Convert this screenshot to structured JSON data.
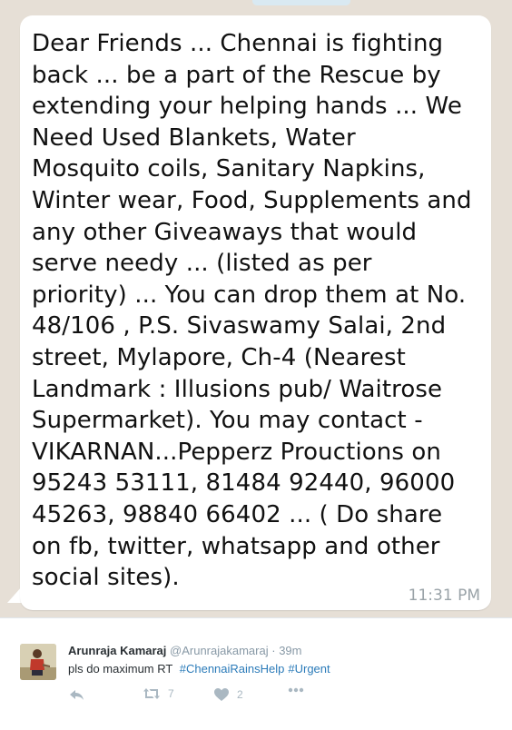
{
  "message": {
    "lines": [
      "Dear Friends ... Chennai is fighting",
      "back ...  be a part of the Rescue  by",
      "extending your helping hands ... We",
      "Need Used Blankets, Water",
      "Mosquito coils, Sanitary Napkins,",
      "Winter wear, Food, Supplements and",
      "any other Giveaways that would",
      "serve needy ... (listed as per",
      "priority) ... You can drop them at No.",
      "48/106 , P.S. Sivaswamy Salai, 2nd",
      "street, Mylapore, Ch-4 (Nearest",
      "Landmark : Illusions pub/ Waitrose",
      "Supermarket). You may contact -",
      "VIKARNAN...Pepperz Prouctions on",
      "95243 53111,  81484 92440, 96000",
      "45263, 98840 66402 ... ( Do share",
      "on fb, twitter, whatsapp and other",
      "social sites)."
    ],
    "time": "11:31 PM"
  },
  "tweet": {
    "name": "Arunraja Kamaraj",
    "handle": "@Arunrajakamaraj",
    "separator": "·",
    "time": "39m",
    "text": "pls do maximum RT",
    "hashtags": [
      "#ChennaiRainsHelp",
      "#Urgent"
    ],
    "retweet_count": "7",
    "like_count": "2",
    "icons": {
      "reply": "reply-icon",
      "retweet": "retweet-icon",
      "like": "heart-icon",
      "more": "more-icon"
    }
  },
  "colors": {
    "chat_background": "#e6dfd6",
    "bubble": "#ffffff",
    "hashtag": "#2b7bb9",
    "muted": "#8899a6"
  }
}
